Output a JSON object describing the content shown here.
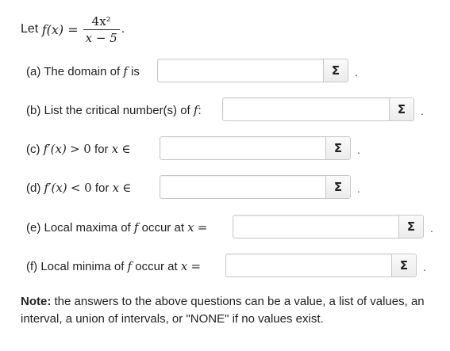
{
  "intro": {
    "prefix": "Let",
    "func": "f(x) =",
    "numerator": "4x²",
    "denominator": "x − 5",
    "suffix": "."
  },
  "questions": [
    {
      "id": "a",
      "label": "(a) The domain of",
      "math": "f",
      "after": "is",
      "sigma": "Σ",
      "value": ""
    },
    {
      "id": "b",
      "label": "(b) List the critical number(s) of",
      "math": "f",
      "after": ":",
      "sigma": "Σ",
      "value": ""
    },
    {
      "id": "c",
      "label": "(c)",
      "math": "f′(x)",
      "after_math": "> 0",
      "after": "for",
      "math2": "x",
      "after2": "∈",
      "sigma": "Σ",
      "value": ""
    },
    {
      "id": "d",
      "label": "(d)",
      "math": "f′(x)",
      "after_math": "< 0",
      "after": "for",
      "math2": "x",
      "after2": "∈",
      "sigma": "Σ",
      "value": ""
    },
    {
      "id": "e",
      "label": "(e) Local maxima of",
      "math": "f",
      "after": "occur at",
      "math2": "x",
      "after2": "=",
      "sigma": "Σ",
      "value": ""
    },
    {
      "id": "f",
      "label": "(f) Local minima of",
      "math": "f",
      "after": "occur at",
      "math2": "x",
      "after2": "=",
      "sigma": "Σ",
      "value": ""
    }
  ],
  "trailing_dot": ".",
  "note": {
    "bold": "Note:",
    "text": "the answers to the above questions can be a value, a list of values, an interval, a union of intervals, or \"NONE\" if no values exist."
  }
}
